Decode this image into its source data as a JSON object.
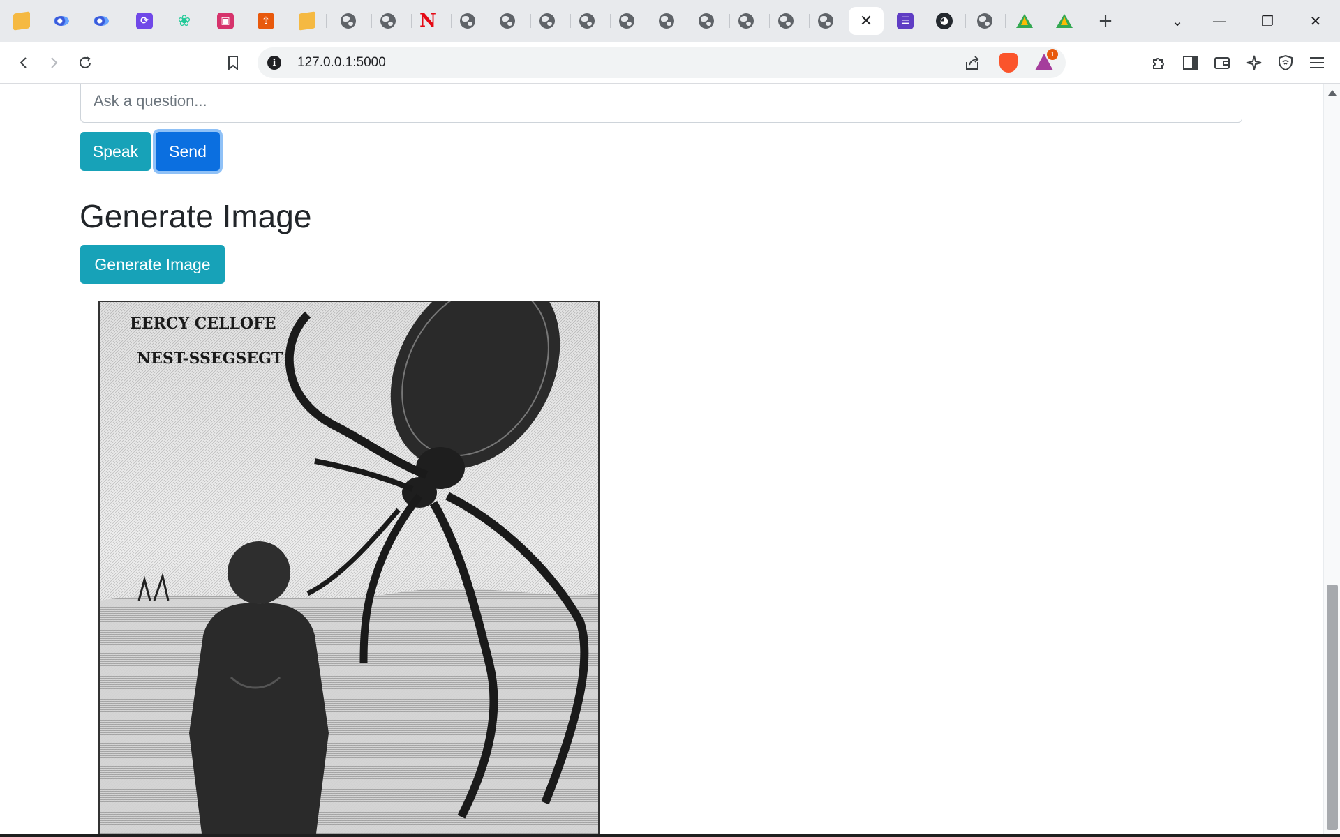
{
  "browser": {
    "tabs": [
      {
        "icon": "package-icon",
        "active": false
      },
      {
        "icon": "eye-logo-icon",
        "active": false
      },
      {
        "icon": "eye-logo-icon",
        "active": false
      },
      {
        "icon": "purple-app-icon",
        "active": false
      },
      {
        "icon": "brain-icon",
        "active": false
      },
      {
        "icon": "pink-app-icon",
        "active": false
      },
      {
        "icon": "orange-upload-icon",
        "active": false
      },
      {
        "icon": "package-icon",
        "active": false
      },
      {
        "icon": "globe-icon",
        "active": false
      },
      {
        "icon": "globe-icon",
        "active": false
      },
      {
        "icon": "netflix-icon",
        "active": false
      },
      {
        "icon": "globe-icon",
        "active": false
      },
      {
        "icon": "globe-icon",
        "active": false
      },
      {
        "icon": "globe-icon",
        "active": false
      },
      {
        "icon": "globe-icon",
        "active": false
      },
      {
        "icon": "globe-icon",
        "active": false
      },
      {
        "icon": "globe-icon",
        "active": false
      },
      {
        "icon": "globe-icon",
        "active": false
      },
      {
        "icon": "globe-icon",
        "active": false
      },
      {
        "icon": "globe-icon",
        "active": false
      },
      {
        "icon": "globe-icon",
        "active": false
      },
      {
        "icon": "close-icon",
        "active": true
      },
      {
        "icon": "sheet-list-icon",
        "active": false
      },
      {
        "icon": "github-icon",
        "active": false
      },
      {
        "icon": "globe-icon",
        "active": false
      },
      {
        "icon": "google-drive-icon",
        "active": false
      },
      {
        "icon": "google-drive-icon",
        "active": false
      }
    ],
    "new_tab_symbol": "+",
    "tab_search_symbol": "⌄",
    "minimize_symbol": "—",
    "restore_symbol": "❐",
    "close_symbol": "✕",
    "url": "127.0.0.1:5000",
    "rewards_badge": "1",
    "colors": {
      "tabstrip_bg": "#e8eaed",
      "brave_orange": "#fb542b",
      "rewards_purple": "#a53d9c"
    }
  },
  "chat": {
    "question_placeholder": "Ask a question...",
    "question_value": "",
    "speak_label": "Speak",
    "send_label": "Send"
  },
  "image_section": {
    "title": "Generate Image",
    "generate_label": "Generate Image",
    "image_caption_lines": [
      "EERCY CELLOFE",
      "NEST-SSEGSEGT"
    ]
  },
  "colors": {
    "info_button": "#17a2b8",
    "primary_button": "#0b6fe0",
    "focus_ring": "#8fc1f7",
    "heading_text": "#212529"
  }
}
